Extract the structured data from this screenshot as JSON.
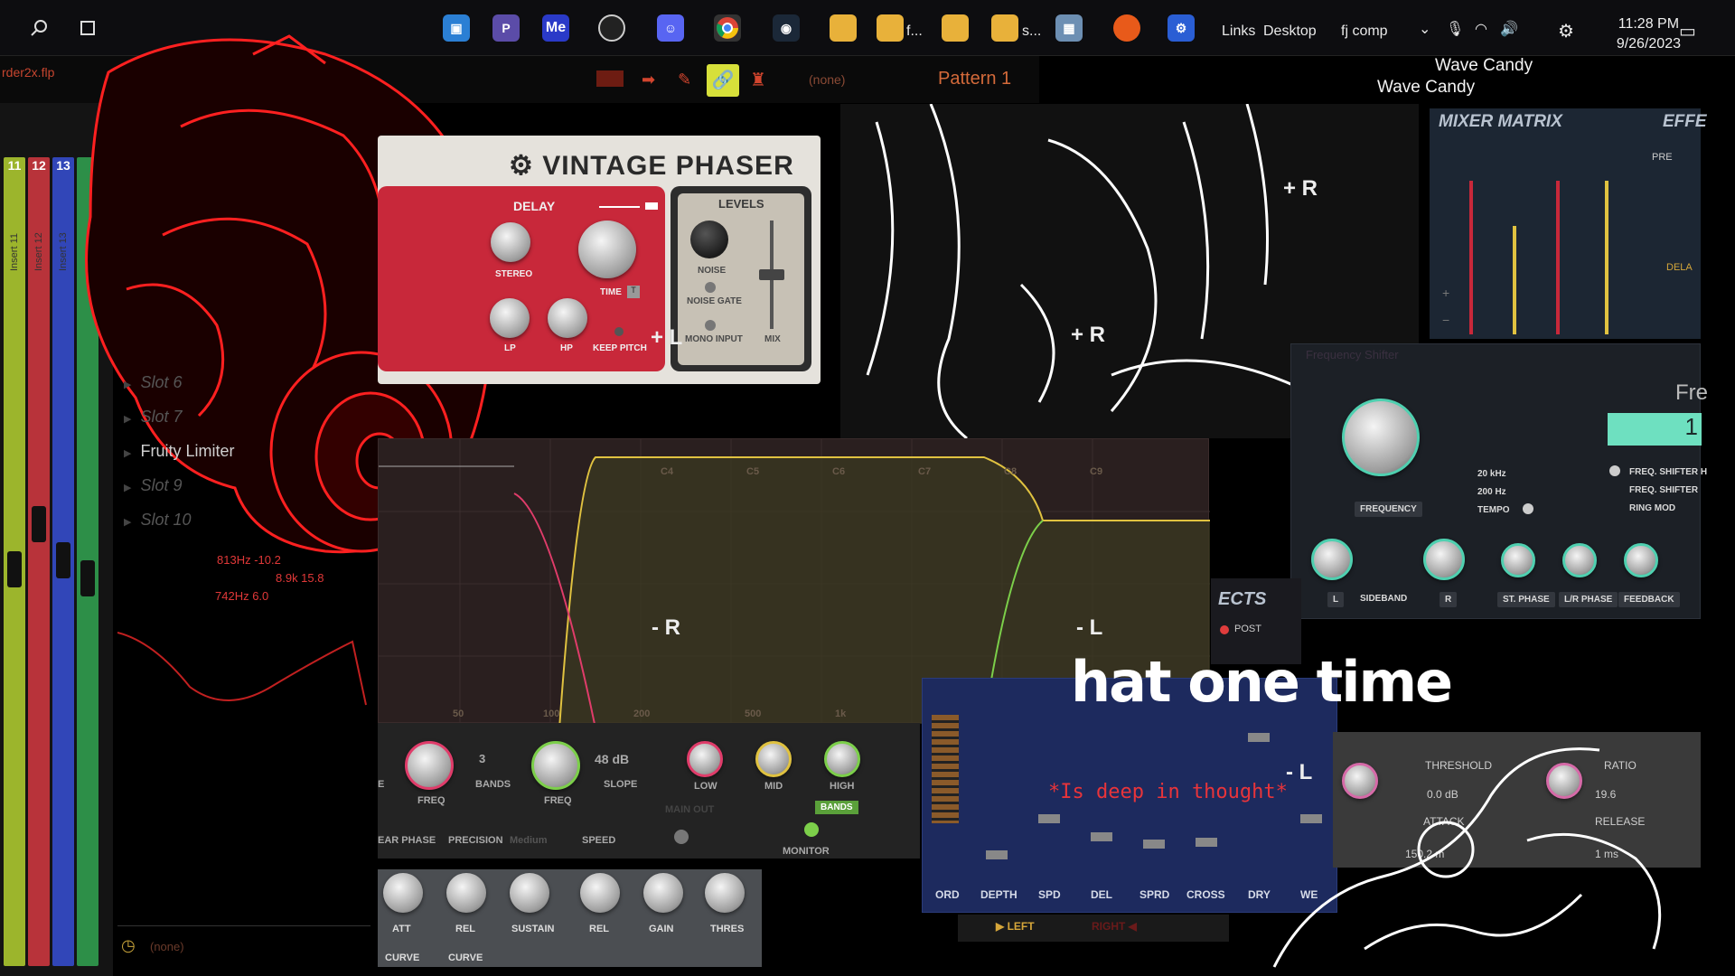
{
  "taskbar": {
    "links_label": "Links",
    "desktop_label": "Desktop",
    "fjcomp_label": "fj comp",
    "time": "11:28 PM",
    "date": "9/26/2023",
    "folder_f": "f...",
    "folder_s": "s...",
    "me_label": "Me"
  },
  "fl": {
    "file_name": "rder2x.flp",
    "pattern": "Pattern 1",
    "channel": "(none)",
    "wave_candy_1": "Wave Candy",
    "wave_candy_2": "Wave Candy"
  },
  "mixer": {
    "strips": [
      {
        "num": "11",
        "label": "Insert 11",
        "color": "#b8d12f"
      },
      {
        "num": "12",
        "label": "Insert 12",
        "color": "#d13a3a"
      },
      {
        "num": "13",
        "label": "Insert 13",
        "color": "#3049c9"
      },
      {
        "num": "",
        "label": "",
        "color": "#2ea34a"
      }
    ],
    "slots": [
      {
        "label": "Slot 6"
      },
      {
        "label": "Slot 7"
      },
      {
        "label": "Fruity Limiter"
      },
      {
        "label": "Slot 9"
      },
      {
        "label": "Slot 10"
      }
    ],
    "hz_readouts": [
      "813Hz -10.2",
      "8.9k 15.8",
      "742Hz 6.0"
    ],
    "footer": "(none)"
  },
  "phaser": {
    "title": "VINTAGE PHASER",
    "delay": "DELAY",
    "stereo": "STEREO",
    "time": "TIME",
    "lp": "LP",
    "hp": "HP",
    "keep_pitch": "KEEP PITCH",
    "levels": "LEVELS",
    "noise": "NOISE",
    "noise_gate": "NOISE GATE",
    "mono_input": "MONO INPUT",
    "mix": "MIX"
  },
  "eq": {
    "freq_labels": [
      "50",
      "100",
      "200",
      "500",
      "1k"
    ],
    "note_labels": [
      "C4",
      "C5",
      "C6",
      "C7",
      "C8",
      "C9"
    ],
    "overlay_r": "- R",
    "overlay_l": "- L",
    "bands_count": "3",
    "bands": "BANDS",
    "freq": "FREQ",
    "slope_value": "48 dB",
    "slope": "SLOPE",
    "low": "LOW",
    "mid": "MID",
    "high": "HIGH",
    "main_out": "MAIN OUT",
    "bands_btn": "BANDS",
    "linear_phase": "EAR PHASE",
    "precision": "PRECISION",
    "precision_value": "Medium",
    "speed": "SPEED",
    "monitor": "MONITOR",
    "e_label": "E"
  },
  "bottom_knobs": {
    "att": "ATT",
    "rel": "REL",
    "sustain": "SUSTAIN",
    "rel2": "REL",
    "gain": "GAIN",
    "thres": "THRES",
    "curve1": "CURVE",
    "curve2": "CURVE"
  },
  "matrix": {
    "title": "MIXER MATRIX",
    "effects": "EFFE",
    "pre": "PRE",
    "dela": "DELA"
  },
  "effects_box": {
    "title": "ECTS",
    "post": "POST"
  },
  "fshift": {
    "title": "Frequency Shifter",
    "fre": "Fre",
    "value": "1",
    "frequency": "FREQUENCY",
    "r20k": "20 kHz",
    "r200": "200 Hz",
    "tempo": "TEMPO",
    "mode1": "FREQ. SHIFTER H",
    "mode2": "FREQ. SHIFTER",
    "mode3": "RING MOD",
    "l": "L",
    "sideband": "SIDEBAND",
    "r": "R",
    "st_phase": "ST. PHASE",
    "lr_phase": "L/R PHASE",
    "feedback": "FEEDBACK"
  },
  "chorus": {
    "ord": "ORD",
    "depth": "DEPTH",
    "spd": "SPD",
    "del": "DEL",
    "sprd": "SPRD",
    "cross": "CROSS",
    "dry": "DRY",
    "wet": "WE",
    "left": "LEFT",
    "right": "RIGHT",
    "caption": "*Is deep in thought*",
    "l_marker": "- L"
  },
  "comp": {
    "threshold": "THRESHOLD",
    "ratio": "RATIO",
    "thr_value": "0.0 dB",
    "ratio_value": "19.6",
    "attack": "ATTACK",
    "release": "RELEASE",
    "att_value": "150.2 m",
    "rel_value": "1 ms"
  },
  "overlays": {
    "lyric": "hat one time",
    "plus_r": "+ R",
    "plus_r2": "+ R",
    "plus_l": "+ L"
  },
  "colors": {
    "neon_red": "#ff2020",
    "phaser_red": "#c8283a",
    "eq_green": "#7ccf4a",
    "eq_yellow": "#e0c240",
    "fs_teal": "#4fd0b0"
  }
}
